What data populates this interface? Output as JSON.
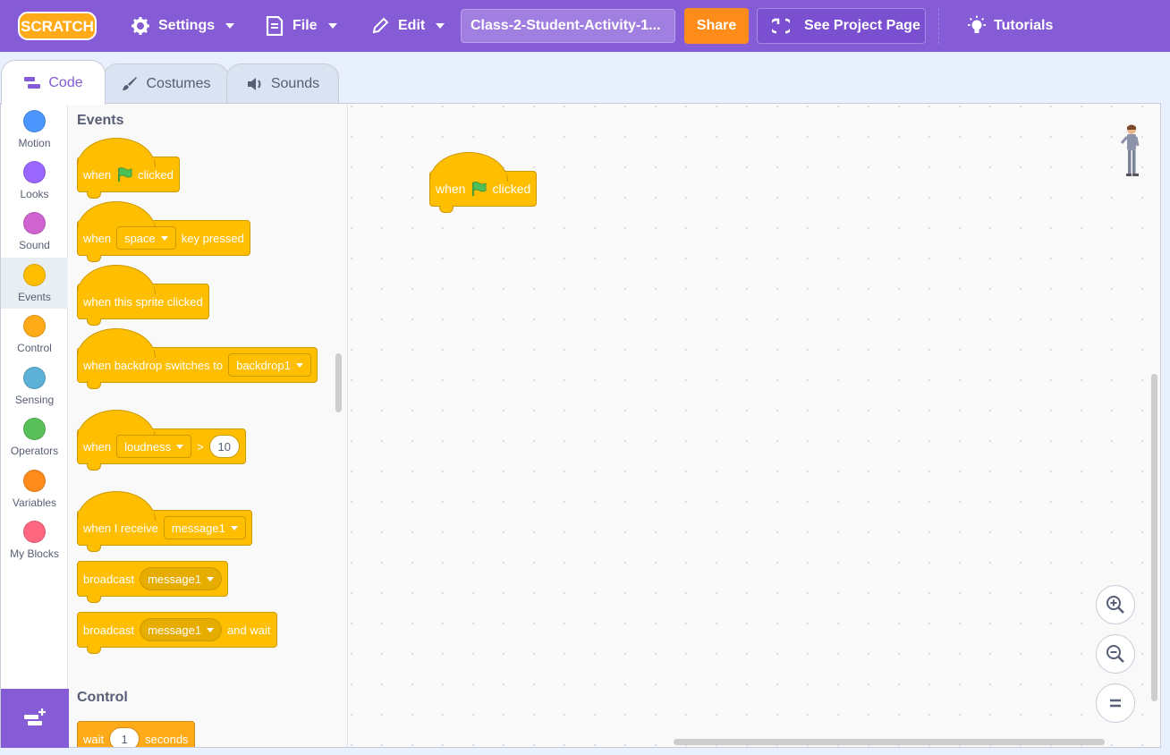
{
  "menubar": {
    "logo_text": "SCRATCH",
    "settings_label": "Settings",
    "file_label": "File",
    "edit_label": "Edit",
    "project_title": "Class-2-Student-Activity-1...",
    "share_label": "Share",
    "see_project_label": "See Project Page",
    "tutorials_label": "Tutorials"
  },
  "tabs": {
    "code": "Code",
    "costumes": "Costumes",
    "sounds": "Sounds"
  },
  "categories": [
    {
      "label": "Motion",
      "color": "#4c97ff"
    },
    {
      "label": "Looks",
      "color": "#9966ff"
    },
    {
      "label": "Sound",
      "color": "#cf63cf"
    },
    {
      "label": "Events",
      "color": "#ffbf00"
    },
    {
      "label": "Control",
      "color": "#ffab19"
    },
    {
      "label": "Sensing",
      "color": "#5cb1d6"
    },
    {
      "label": "Operators",
      "color": "#59c059"
    },
    {
      "label": "Variables",
      "color": "#ff8c1a"
    },
    {
      "label": "My Blocks",
      "color": "#ff6680"
    }
  ],
  "palette": {
    "events_heading": "Events",
    "control_heading": "Control",
    "blocks": {
      "flag_when": "when",
      "flag_clicked": "clicked",
      "key_when": "when",
      "key_value": "space",
      "key_pressed": "key pressed",
      "sprite_clicked": "when this sprite clicked",
      "backdrop_text": "when backdrop switches to",
      "backdrop_value": "backdrop1",
      "loud_when": "when",
      "loud_value": "loudness",
      "loud_op": ">",
      "loud_num": "10",
      "receive_text": "when I receive",
      "receive_value": "message1",
      "broadcast_text": "broadcast",
      "broadcast_value": "message1",
      "bwait_text": "broadcast",
      "bwait_value": "message1",
      "bwait_suffix": "and wait",
      "wait_text": "wait",
      "wait_num": "1",
      "wait_suffix": "seconds"
    }
  },
  "workspace": {
    "script_when": "when",
    "script_clicked": "clicked"
  }
}
